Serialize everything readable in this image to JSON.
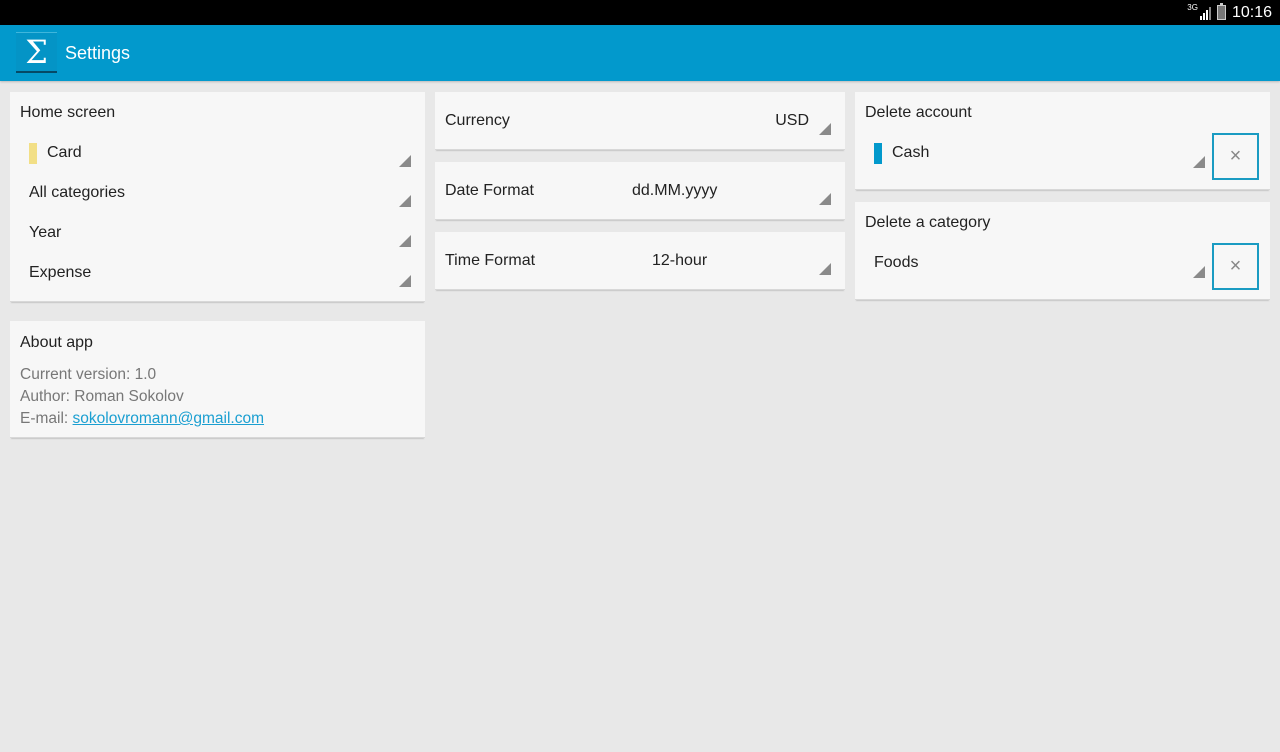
{
  "status_bar": {
    "network_label": "3G",
    "time": "10:16",
    "icons": [
      "signal-icon",
      "battery-icon"
    ]
  },
  "action_bar": {
    "app_icon_glyph": "Σ",
    "title": "Settings"
  },
  "home_screen": {
    "title": "Home screen",
    "spinners": [
      {
        "label": "Card",
        "swatch_color": "#f2df86"
      },
      {
        "label": "All categories"
      },
      {
        "label": "Year"
      },
      {
        "label": "Expense"
      }
    ]
  },
  "about": {
    "title": "About app",
    "version_line": "Current version: 1.0",
    "author_line": "Author: Roman Sokolov",
    "email_label": "E-mail: ",
    "email": "sokolovromann@gmail.com"
  },
  "preferences": {
    "currency": {
      "label": "Currency",
      "value": "USD"
    },
    "date_format": {
      "label": "Date Format",
      "value": "dd.MM.yyyy"
    },
    "time_format": {
      "label": "Time Format",
      "value": "12-hour"
    }
  },
  "delete_account": {
    "title": "Delete account",
    "selected": "Cash",
    "swatch_color": "#0299cc",
    "button_glyph": "×"
  },
  "delete_category": {
    "title": "Delete a category",
    "selected": "Foods",
    "button_glyph": "×"
  },
  "colors": {
    "accent": "#0299cc",
    "background": "#e8e8e8",
    "card": "#f7f7f7"
  }
}
